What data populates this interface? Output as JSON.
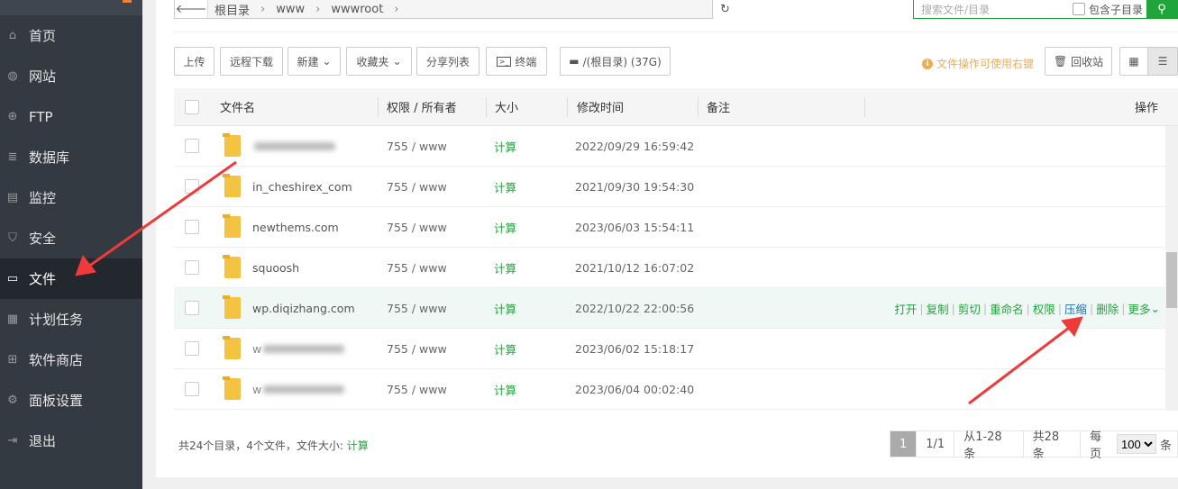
{
  "sidebar": {
    "items": [
      {
        "label": "首页",
        "icon": "home-icon"
      },
      {
        "label": "网站",
        "icon": "globe-icon"
      },
      {
        "label": "FTP",
        "icon": "ftp-icon"
      },
      {
        "label": "数据库",
        "icon": "database-icon"
      },
      {
        "label": "监控",
        "icon": "monitor-icon"
      },
      {
        "label": "安全",
        "icon": "shield-icon"
      },
      {
        "label": "文件",
        "icon": "folder-icon",
        "active": true
      },
      {
        "label": "计划任务",
        "icon": "calendar-icon"
      },
      {
        "label": "软件商店",
        "icon": "grid-icon"
      },
      {
        "label": "面板设置",
        "icon": "gear-icon"
      },
      {
        "label": "退出",
        "icon": "logout-icon"
      }
    ]
  },
  "breadcrumb": [
    "根目录",
    "www",
    "wwwroot"
  ],
  "search": {
    "placeholder": "搜索文件/目录",
    "include_sub": "包含子目录"
  },
  "toolbar": {
    "upload": "上传",
    "remote_download": "远程下载",
    "new": "新建",
    "favorites": "收藏夹",
    "share_list": "分享列表",
    "terminal": "终端",
    "disk": "/(根目录) (37G)",
    "tip": "文件操作可使用右键",
    "recycle": "回收站"
  },
  "table": {
    "headers": {
      "name": "文件名",
      "perm": "权限 / 所有者",
      "size": "大小",
      "mtime": "修改时间",
      "note": "备注",
      "ops": "操作"
    },
    "rows": [
      {
        "name": "",
        "perm": "755 / www",
        "size": "计算",
        "mtime": "2022/09/29 16:59:42",
        "blurred": true
      },
      {
        "name": "in_cheshirex_com",
        "perm": "755 / www",
        "size": "计算",
        "mtime": "2021/09/30 19:54:30"
      },
      {
        "name": "newthems.com",
        "perm": "755 / www",
        "size": "计算",
        "mtime": "2023/06/03 15:54:11"
      },
      {
        "name": "squoosh",
        "perm": "755 / www",
        "size": "计算",
        "mtime": "2021/10/12 16:07:02"
      },
      {
        "name": "wp.diqizhang.com",
        "perm": "755 / www",
        "size": "计算",
        "mtime": "2022/10/22 22:00:56",
        "hover": true
      },
      {
        "name": "w",
        "perm": "755 / www",
        "size": "计算",
        "mtime": "2023/06/02 15:18:17",
        "blurred": true
      },
      {
        "name": "w",
        "perm": "755 / www",
        "size": "计算",
        "mtime": "2023/06/04 00:02:40",
        "blurred": true
      }
    ],
    "row_ops": [
      "打开",
      "复制",
      "剪切",
      "重命名",
      "权限",
      "压缩",
      "删除",
      "更多"
    ]
  },
  "footer": {
    "summary": "共24个目录，4个文件，文件大小: ",
    "calc": "计算"
  },
  "pager": {
    "current": "1",
    "pages": "1/1",
    "range": "从1-28条",
    "total": "共28条",
    "per_page_label": "每页",
    "per_page": "100",
    "unit": "条"
  },
  "colors": {
    "accent": "#20a53a",
    "sidebar": "#333a42",
    "annotation_arrow": "#f03a3a"
  }
}
